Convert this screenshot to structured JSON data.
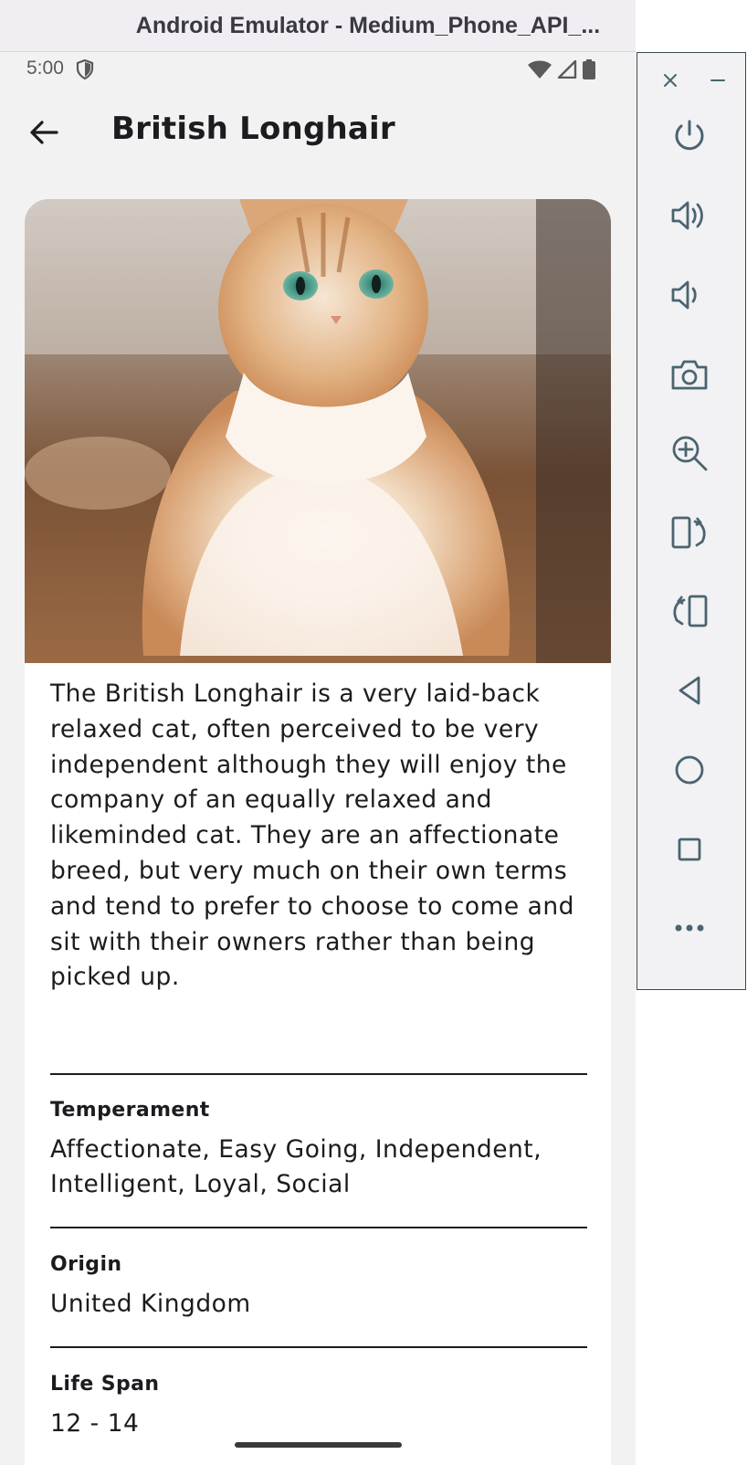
{
  "window": {
    "title": "Android Emulator - Medium_Phone_API_..."
  },
  "statusbar": {
    "time": "5:00",
    "icons": [
      "shield-icon",
      "wifi-icon",
      "signal-icon",
      "battery-icon"
    ]
  },
  "appbar": {
    "title": "British Longhair",
    "back_icon": "arrow-back-icon"
  },
  "breed": {
    "image_alt": "British Longhair",
    "description": "The British Longhair is a very laid-back relaxed cat, often perceived to be very independent although they will enjoy the company of an equally relaxed and likeminded cat. They are an affectionate breed, but very much on their own terms and tend to prefer to choose to come and sit with their owners rather than being picked up.",
    "attributes": [
      {
        "label": "Temperament",
        "value": "Affectionate, Easy Going, Independent, Intelligent, Loyal, Social"
      },
      {
        "label": "Origin",
        "value": "United Kingdom"
      },
      {
        "label": "Life Span",
        "value": "12 - 14"
      }
    ]
  },
  "emulator_toolbar": {
    "items": [
      "close-icon",
      "minimize-icon",
      "power-icon",
      "volume-up-icon",
      "volume-down-icon",
      "camera-icon",
      "zoom-icon",
      "rotate-left-icon",
      "rotate-right-icon",
      "back-icon",
      "home-icon",
      "overview-icon",
      "more-icon"
    ]
  },
  "colors": {
    "text": "#1c1b1f",
    "background": "#f2f2f2",
    "card": "#ffffff",
    "toolbar_icon": "#4a6470"
  }
}
